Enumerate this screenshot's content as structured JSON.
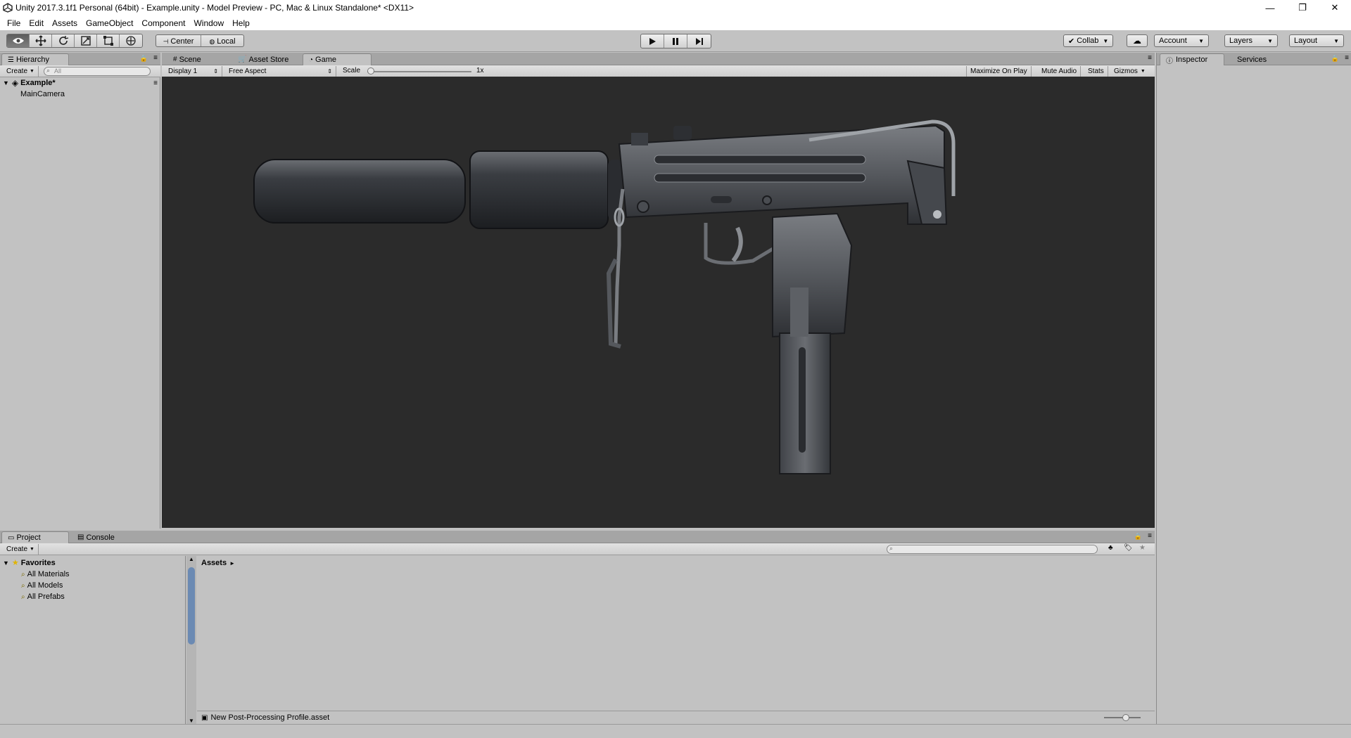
{
  "window": {
    "title": "Unity 2017.3.1f1 Personal (64bit) - Example.unity - Model Preview - PC, Mac & Linux Standalone* <DX11>",
    "minimize": "—",
    "restore": "❐",
    "close": "✕"
  },
  "menu": [
    "File",
    "Edit",
    "Assets",
    "GameObject",
    "Component",
    "Window",
    "Help"
  ],
  "toolbar": {
    "tools": [
      "view-tool",
      "move-tool",
      "rotate-tool",
      "scale-tool",
      "rect-tool",
      "transform-tool"
    ],
    "pivot_mode": "Center",
    "pivot_rotation": "Local",
    "collab": "Collab",
    "account": "Account",
    "layers": "Layers",
    "layout": "Layout"
  },
  "hierarchy": {
    "tab": "Hierarchy",
    "create": "Create",
    "search_placeholder": "All",
    "scene": "Example*",
    "items": [
      "MainCamera"
    ]
  },
  "center_tabs": {
    "scene": "Scene",
    "asset_store": "Asset Store",
    "game": "Game"
  },
  "game_toolbar": {
    "display": "Display 1",
    "aspect": "Free Aspect",
    "scale_label": "Scale",
    "scale_value": "1x",
    "maximize": "Maximize On Play",
    "mute": "Mute Audio",
    "stats": "Stats",
    "gizmos": "Gizmos"
  },
  "inspector": {
    "tab": "Inspector",
    "services": "Services"
  },
  "project": {
    "tab": "Project",
    "console": "Console",
    "create": "Create",
    "favorites": "Favorites",
    "favorite_items": [
      "All Materials",
      "All Models",
      "All Prefabs"
    ],
    "breadcrumb": "Assets",
    "asset_file": "New Post-Processing Profile.asset"
  },
  "colors": {
    "editor_bg": "#c2c2c2",
    "game_bg": "#2b2b2b",
    "tab_bar": "#a5a5a5"
  }
}
